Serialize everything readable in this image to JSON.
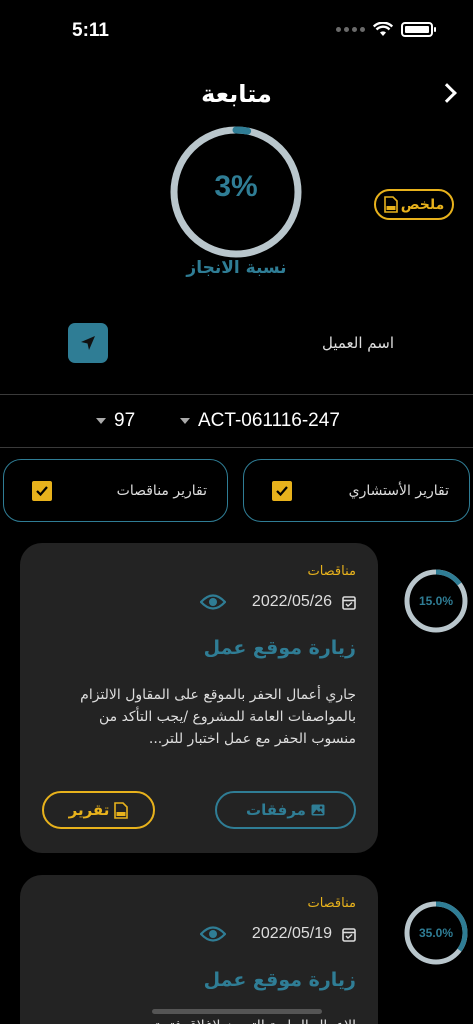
{
  "status_bar": {
    "time": "5:11"
  },
  "header": {
    "title": "متابعة"
  },
  "progress": {
    "percent_label": "3%",
    "fraction": 0.03,
    "label": "نسبة الانجاز"
  },
  "summary_button": {
    "label": "ملخص"
  },
  "client": {
    "label": "اسم العميل"
  },
  "selectors": {
    "number": "97",
    "activity": "ACT-061116-247"
  },
  "filters": [
    {
      "label": "تقارير الأستشاري",
      "checked": true
    },
    {
      "label": "تقارير مناقصات",
      "checked": true
    }
  ],
  "reports": [
    {
      "category": "مناقصات",
      "date": "2022/05/26",
      "title": "زيارة موقع عمل",
      "body": "جاري أعمال الحفر بالموقع على المقاول الالتزام بالمواصفات العامة للمشروع /يجب التأكد من منسوب الحفر مع عمل اختبار للتر...",
      "progress_label": "15.0%",
      "progress_fraction": 0.15,
      "attachments_label": "مرفقات",
      "report_label": "تقرير"
    },
    {
      "category": "مناقصات",
      "date": "2022/05/19",
      "title": "زيارة موقع عمل",
      "body": "الاعمال الجارية التجهيز لاغلاق فتحة",
      "progress_label": "35.0%",
      "progress_fraction": 0.35
    }
  ],
  "colors": {
    "accent": "#2f7d95",
    "gold": "#e8b21c",
    "card": "#232323",
    "ring_track": "#b9c6cc"
  }
}
